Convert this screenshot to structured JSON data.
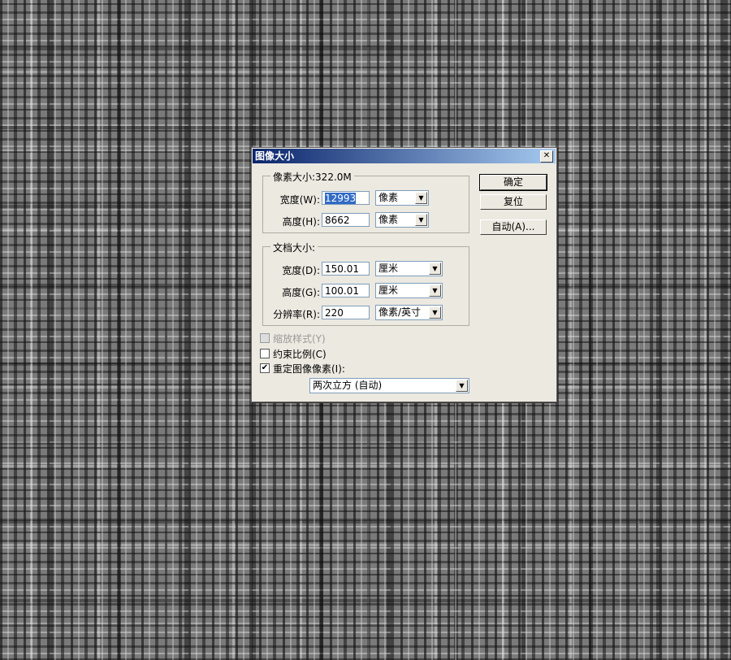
{
  "dialog": {
    "title": "图像大小",
    "close_glyph": "✕",
    "buttons": {
      "ok": "确定",
      "reset": "复位",
      "auto": "自动(A)..."
    },
    "pixel_group": {
      "legend": "像素大小:322.0M",
      "width_label": "宽度(W):",
      "width_value": "12993",
      "width_unit": "像素",
      "height_label": "高度(H):",
      "height_value": "8662",
      "height_unit": "像素"
    },
    "doc_group": {
      "legend": "文档大小:",
      "width_label": "宽度(D):",
      "width_value": "150.01",
      "width_unit": "厘米",
      "height_label": "高度(G):",
      "height_value": "100.01",
      "height_unit": "厘米",
      "res_label": "分辨率(R):",
      "res_value": "220",
      "res_unit": "像素/英寸"
    },
    "options": {
      "scale_styles": "缩放样式(Y)",
      "constrain": "约束比例(C)",
      "resample": "重定图像像素(I):",
      "resample_method": "两次立方 (自动)",
      "check_glyph": "✔"
    }
  }
}
